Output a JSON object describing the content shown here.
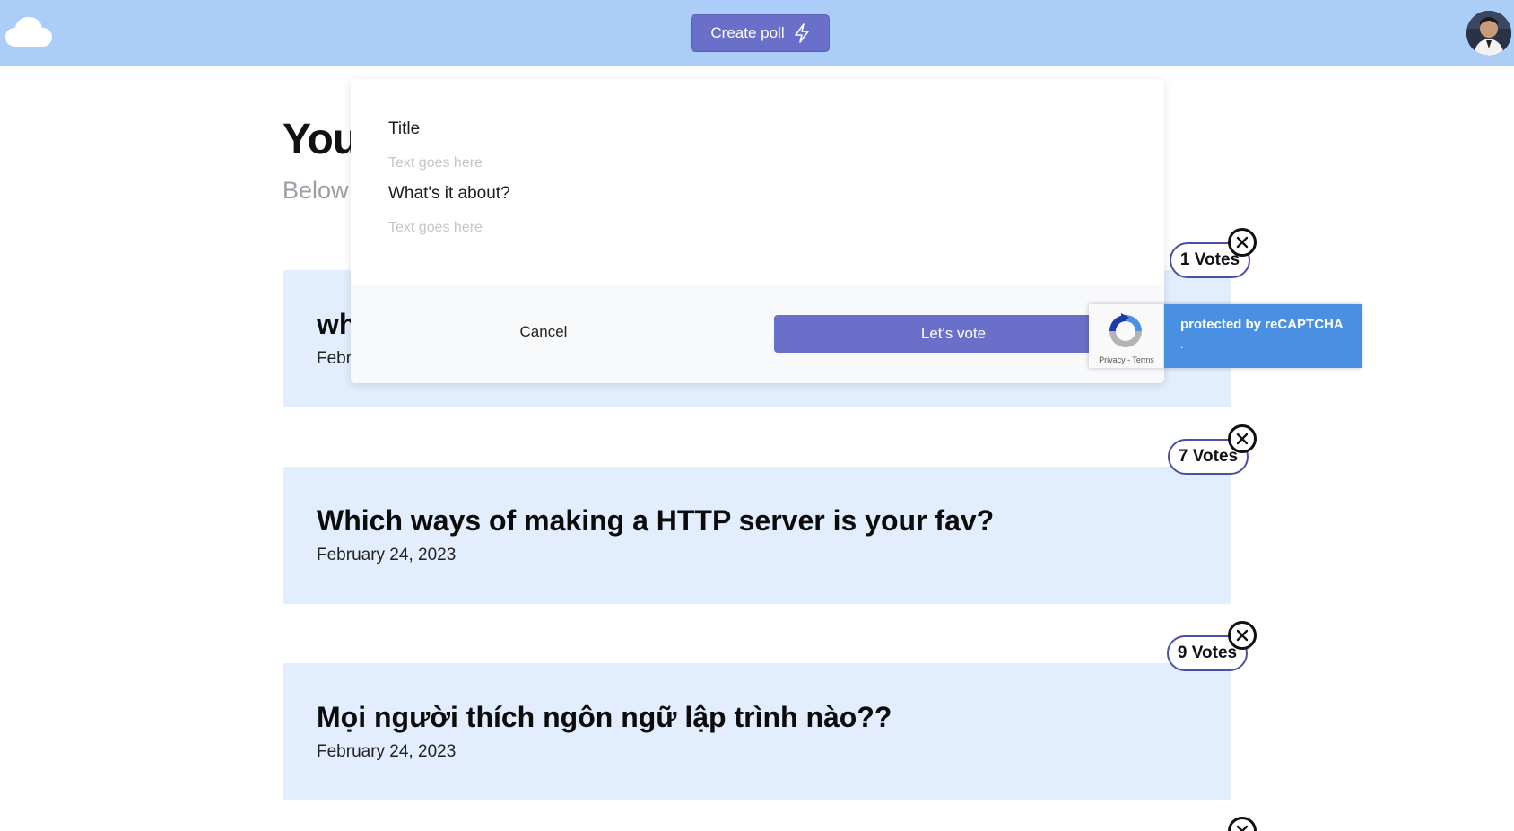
{
  "header": {
    "create_poll_label": "Create poll"
  },
  "page": {
    "title": "You",
    "subtitle": "Below"
  },
  "modal": {
    "title_label": "Title",
    "title_placeholder": "Text goes here",
    "about_label": "What's it about?",
    "about_placeholder": "Text goes here",
    "cancel_label": "Cancel",
    "vote_label": "Let's vote"
  },
  "recaptcha": {
    "text": "protected by reCAPTCHA",
    "dot": ".",
    "links": "Privacy - Terms"
  },
  "polls": [
    {
      "title": "wh",
      "date": "Febr",
      "votes": "1 Votes"
    },
    {
      "title": "Which ways of making a HTTP server is your fav?",
      "date": "February 24, 2023",
      "votes": "7 Votes"
    },
    {
      "title": "Mọi người thích ngôn ngữ lập trình nào??",
      "date": "February 24, 2023",
      "votes": "9 Votes"
    }
  ],
  "colors": {
    "header_bg": "#abcdf8",
    "accent": "#6a6fc9",
    "card_bg": "#e2edfd",
    "recaptcha_blue": "#4a90e2"
  },
  "icons": {
    "logo": "cloud-icon",
    "create_poll": "lightning-icon",
    "delete": "close-circle-icon",
    "recaptcha": "recaptcha-logo-icon"
  }
}
